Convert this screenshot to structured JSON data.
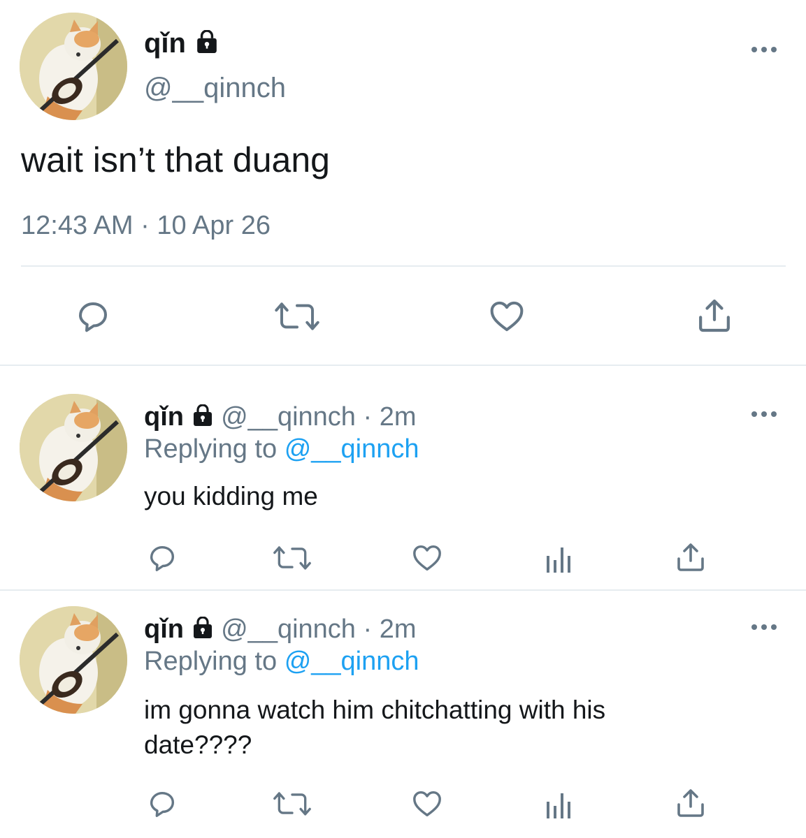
{
  "main_tweet": {
    "display_name": "qǐn",
    "handle": "@__qinnch",
    "text": "wait isn’t that duang",
    "timestamp": "12:43 AM · 10 Apr 26",
    "icons": [
      "reply-icon",
      "retweet-icon",
      "like-icon",
      "share-icon"
    ]
  },
  "replies": [
    {
      "display_name": "qǐn",
      "handle": "@__qinnch",
      "time": "· 2m",
      "replying_prefix": "Replying to",
      "replying_to": "@__qinnch",
      "text_lines": [
        "you kidding me"
      ]
    },
    {
      "display_name": "qǐn",
      "handle": "@__qinnch",
      "time": "· 2m",
      "replying_prefix": "Replying to",
      "replying_to": "@__qinnch",
      "text_lines": [
        "im gonna watch him chitchatting with his",
        "date????"
      ]
    }
  ],
  "colors": {
    "text": "#14171a",
    "secondary": "#657786",
    "link": "#1da1f2",
    "divider": "#e6ecf0"
  }
}
